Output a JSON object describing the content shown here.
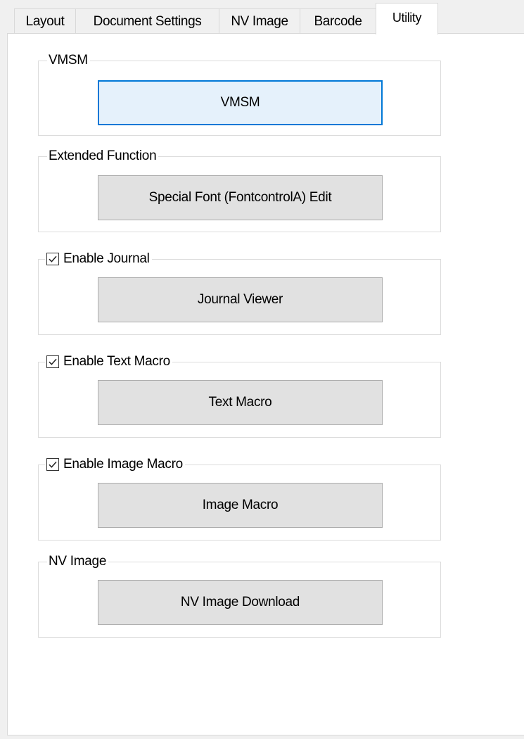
{
  "tabs": [
    {
      "label": "Layout",
      "active": false
    },
    {
      "label": "Document Settings",
      "active": false
    },
    {
      "label": "NV Image",
      "active": false
    },
    {
      "label": "Barcode",
      "active": false
    },
    {
      "label": "Utility",
      "active": true
    }
  ],
  "groups": {
    "vmsm": {
      "legend": "VMSM",
      "button": "VMSM"
    },
    "extended": {
      "legend": "Extended Function",
      "button": "Special Font (FontcontrolA) Edit"
    },
    "journal": {
      "legend": "Enable Journal",
      "checked": true,
      "button": "Journal Viewer"
    },
    "text_macro": {
      "legend": "Enable Text Macro",
      "checked": true,
      "button": "Text Macro"
    },
    "image_macro": {
      "legend": "Enable Image Macro",
      "checked": true,
      "button": "Image Macro"
    },
    "nv_image": {
      "legend": "NV Image",
      "button": "NV Image Download"
    }
  },
  "colors": {
    "focus_border": "#0078d7",
    "button_face": "#e1e1e1",
    "panel_bg": "#ffffff",
    "window_bg": "#f0f0f0"
  }
}
